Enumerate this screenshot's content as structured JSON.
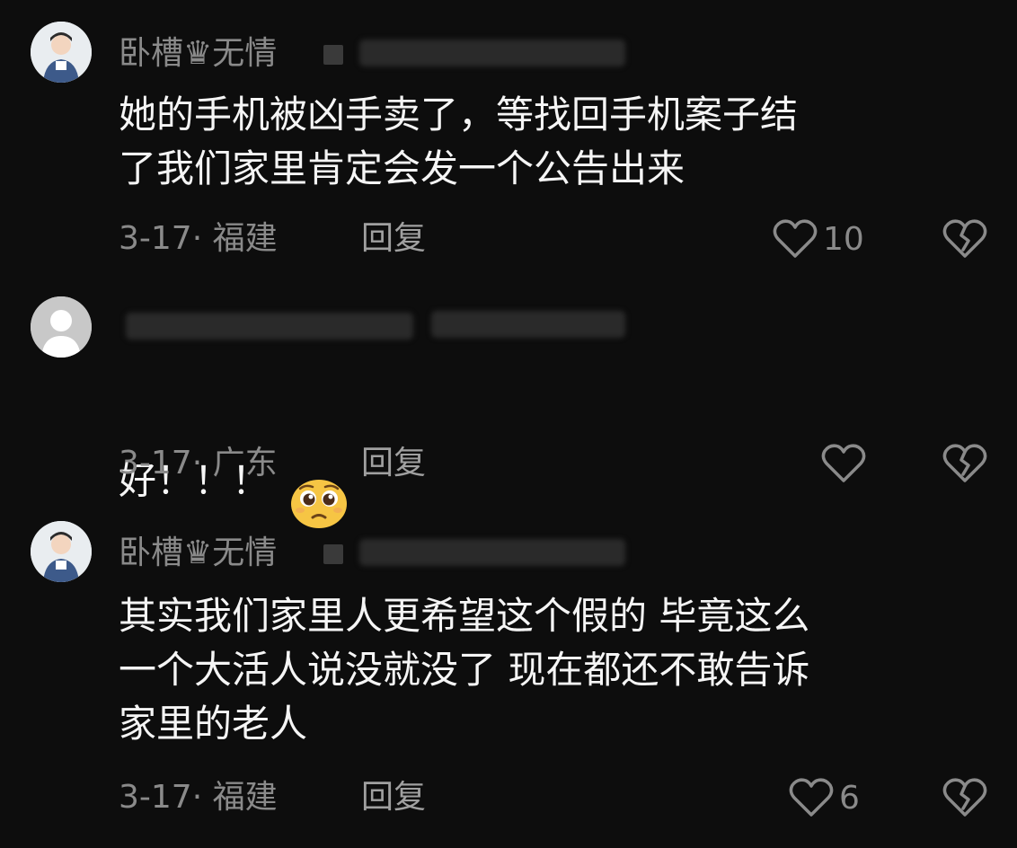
{
  "comments": [
    {
      "username": "卧槽♛无情",
      "text": "她的手机被凶手卖了，等找回手机案子结\n了我们家里肯定会发一个公告出来",
      "meta": "3-17· 福建",
      "reply": "回复",
      "likes": "10"
    },
    {
      "username": "",
      "text": "好！！！",
      "emoji": "pleading-face-emoji",
      "meta": "3-17· 广东",
      "reply": "回复",
      "likes": ""
    },
    {
      "username": "卧槽♛无情",
      "text": "其实我们家里人更希望这个假的 毕竟这么\n一个大活人说没就没了 现在都还不敢告诉\n家里的老人",
      "meta": "3-17· 福建",
      "reply": "回复",
      "likes": "6"
    }
  ],
  "icons": {
    "like": "heart-outline-icon",
    "dislike": "broken-heart-icon"
  },
  "colors": {
    "background": "#0d0d0d",
    "primary_text": "#f5f5f5",
    "secondary_text": "#8a8a8a"
  }
}
